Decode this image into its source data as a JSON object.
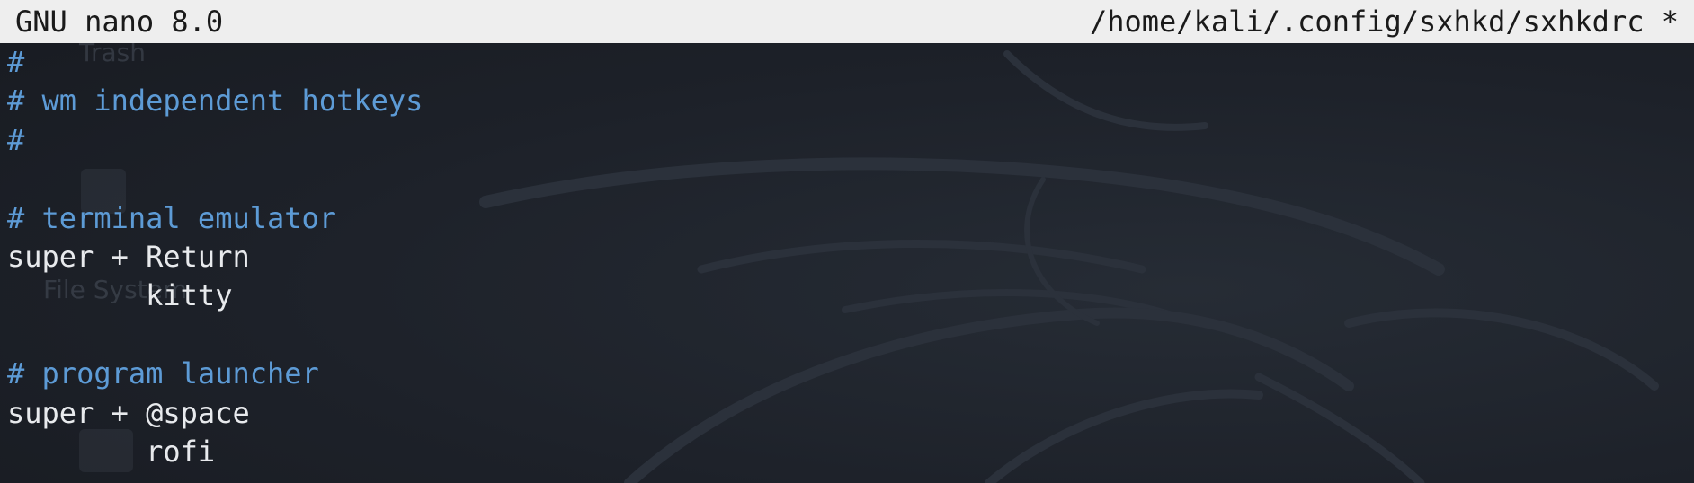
{
  "titlebar": {
    "app_version": "GNU nano 8.0",
    "file_path": "/home/kali/.config/sxhkd/sxhkdrc *"
  },
  "desktop": {
    "icon_labels": [
      "Trash",
      "File System"
    ]
  },
  "editor": {
    "lines": [
      {
        "text": "#",
        "kind": "comment"
      },
      {
        "text": "# wm independent hotkeys",
        "kind": "comment"
      },
      {
        "text": "#",
        "kind": "comment"
      },
      {
        "text": "",
        "kind": "blank"
      },
      {
        "text": "# terminal emulator",
        "kind": "comment"
      },
      {
        "text": "super + Return",
        "kind": "code"
      },
      {
        "text": "        kitty",
        "kind": "code"
      },
      {
        "text": "",
        "kind": "blank"
      },
      {
        "text": "# program launcher",
        "kind": "comment"
      },
      {
        "text": "super + @space",
        "kind": "code"
      },
      {
        "text": "        rofi",
        "kind": "code"
      }
    ]
  },
  "colors": {
    "comment": "#5d9bd6",
    "text": "#e8eaed",
    "titlebar_bg": "#eeeeee",
    "background": "#1c2027"
  }
}
